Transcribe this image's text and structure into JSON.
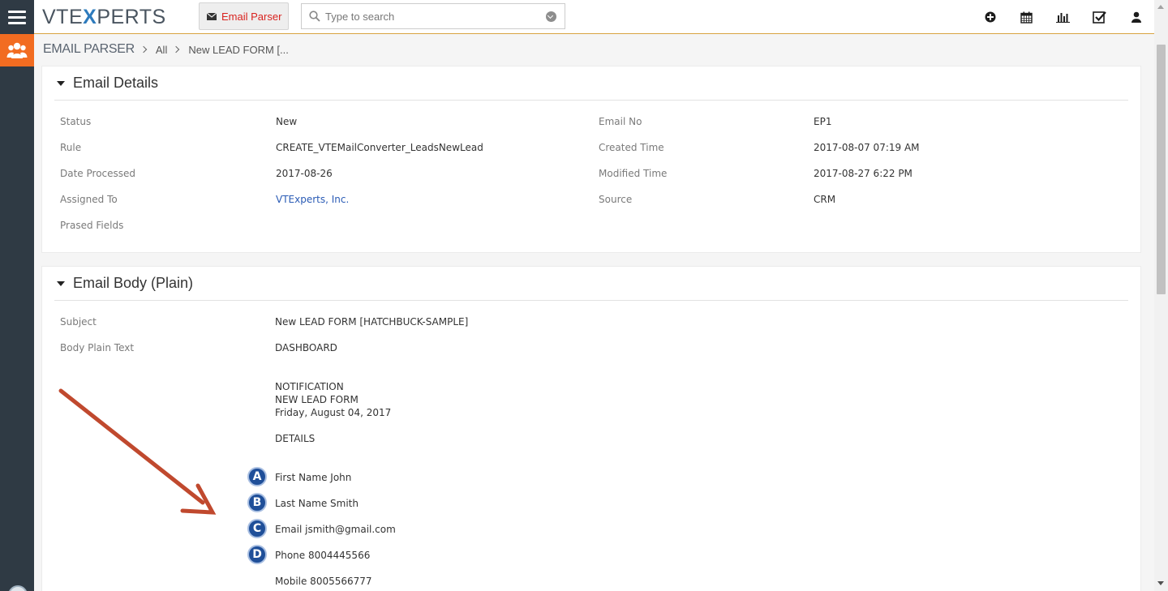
{
  "header": {
    "logo_prefix": "VTE",
    "logo_x": "X",
    "logo_suffix": "PERTS",
    "module_tab_label": "Email Parser",
    "search_placeholder": "Type to search",
    "icons": [
      "plus-circle-icon",
      "calendar-icon",
      "chart-icon",
      "checkbox-icon",
      "user-icon"
    ]
  },
  "breadcrumb": {
    "root": "EMAIL PARSER",
    "items": [
      "All",
      "New LEAD FORM [..."
    ]
  },
  "email_details": {
    "title": "Email Details",
    "fields": [
      {
        "label": "Status",
        "value": "New"
      },
      {
        "label": "Rule",
        "value": "CREATE_VTEMailConverter_LeadsNewLead"
      },
      {
        "label": "Date Processed",
        "value": "2017-08-26"
      },
      {
        "label": "Assigned To",
        "value": "VTExperts, Inc."
      },
      {
        "label": "Prased Fields",
        "value": ""
      },
      {
        "label": "Email No",
        "value": "EP1"
      },
      {
        "label": "Created Time",
        "value": "2017-08-07 07:19 AM"
      },
      {
        "label": "Modified Time",
        "value": "2017-08-27 6:22 PM"
      },
      {
        "label": "Source",
        "value": "CRM"
      }
    ]
  },
  "email_body": {
    "title": "Email Body (Plain)",
    "subject_label": "Subject",
    "subject_value": "New LEAD FORM [HATCHBUCK-SAMPLE]",
    "body_label": "Body Plain Text",
    "lines": [
      "DASHBOARD",
      "NOTIFICATION",
      "NEW LEAD FORM",
      "Friday, August 04, 2017",
      "DETAILS",
      "First Name John",
      "Last Name Smith",
      "Email jsmith@gmail.com",
      "Phone 8004445566",
      "Mobile 8005566777"
    ],
    "badges": [
      "A",
      "B",
      "C",
      "D"
    ]
  },
  "colors": {
    "sidebar": "#2f3a44",
    "accent_orange": "#f26c21",
    "module_tab_text": "#d9231f",
    "link": "#2a5bb5",
    "badge": "#1f4f99",
    "annotation_arrow": "#c0492e"
  }
}
